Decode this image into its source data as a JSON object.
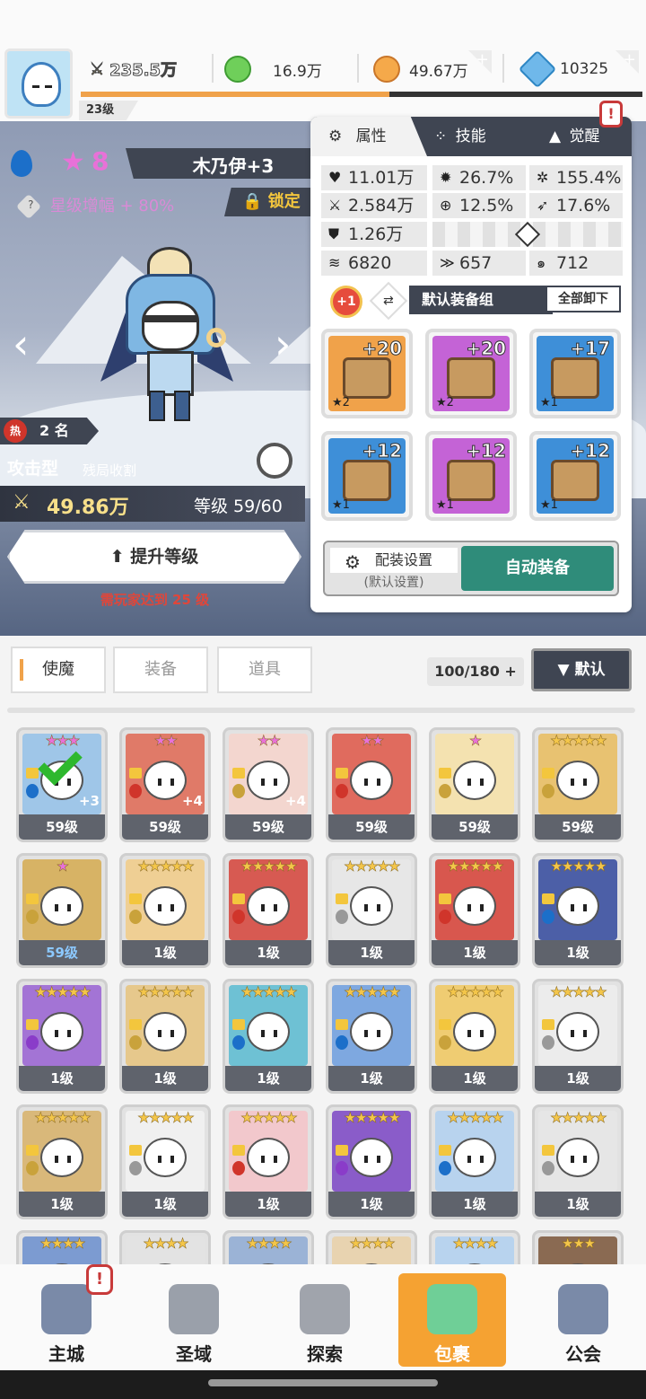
{
  "top": {
    "player_level": "23级",
    "power": "235.5万",
    "resources": [
      {
        "icon": "green-gem-icon",
        "value": "16.9万"
      },
      {
        "icon": "gold-coin-icon",
        "value": "49.67万"
      },
      {
        "icon": "blue-diamond-icon",
        "value": "10325"
      }
    ],
    "xp_fraction": 0.55
  },
  "hero": {
    "star_count": "8",
    "name": "木乃伊+3",
    "star_amp": "星级增幅 + 80%",
    "lock_label": "锁定",
    "hot_rank": "2 名",
    "hot_label": "热",
    "type": "攻击型",
    "type_desc": "残局收割",
    "power": "49.86万",
    "level_text": "等级 59/60",
    "upgrade_label": "提升等级",
    "requirement": "需玩家达到 25 级"
  },
  "panel": {
    "tabs": [
      "属性",
      "技能",
      "觉醒"
    ],
    "alert": "!",
    "stats": [
      {
        "icon": "heart-icon",
        "value": "11.01万"
      },
      {
        "icon": "burst-icon",
        "value": "26.7%"
      },
      {
        "icon": "sun-icon",
        "value": "155.4%"
      },
      {
        "icon": "sword-icon",
        "value": "2.584万"
      },
      {
        "icon": "crosshair-icon",
        "value": "12.5%"
      },
      {
        "icon": "dash-icon",
        "value": "17.6%"
      },
      {
        "icon": "shield-icon",
        "value": "1.26万"
      },
      {
        "icon": "wing-icon",
        "value": "6820"
      },
      {
        "icon": "dodge-icon",
        "value": "657"
      },
      {
        "icon": "swirl-icon",
        "value": "712"
      }
    ],
    "set_plus": "+1",
    "set_name": "默认装备组",
    "unequip_all": "全部卸下",
    "equipment": [
      {
        "name": "sword",
        "level": "+20",
        "stars": "★2",
        "color": "#f0a24a"
      },
      {
        "name": "helmet",
        "level": "+20",
        "stars": "★2",
        "color": "#c463d6"
      },
      {
        "name": "armor",
        "level": "+17",
        "stars": "★1",
        "color": "#3e8fd8"
      },
      {
        "name": "belt",
        "level": "+12",
        "stars": "★1",
        "color": "#3e8fd8"
      },
      {
        "name": "necklace",
        "level": "+12",
        "stars": "★1",
        "color": "#c463d6"
      },
      {
        "name": "boots",
        "level": "+12",
        "stars": "★1",
        "color": "#3e8fd8"
      }
    ],
    "config_label": "配装设置",
    "config_sub": "(默认设置)",
    "auto_equip": "自动装备"
  },
  "inventory": {
    "tabs": [
      "使魔",
      "装备",
      "道具"
    ],
    "capacity": "100/180",
    "capacity_plus": "+",
    "sort_label": "▼ 默认",
    "cards": [
      {
        "stars": "★★★",
        "pink": true,
        "level": "59级",
        "bg": "#9fc6e8",
        "el": "#1c6fc9",
        "plus": "+3",
        "check": true
      },
      {
        "stars": "★★",
        "pink": true,
        "level": "59级",
        "bg": "#e07a68",
        "el": "#d0352b",
        "plus": "+4"
      },
      {
        "stars": "★★",
        "pink": true,
        "level": "59级",
        "bg": "#f3d6cf",
        "el": "#c9a23b",
        "plus": "+4"
      },
      {
        "stars": "★★",
        "pink": true,
        "level": "59级",
        "bg": "#e06b5e",
        "el": "#d0352b"
      },
      {
        "stars": "★",
        "pink": true,
        "level": "59级",
        "bg": "#f4e2b0",
        "el": "#c9a23b"
      },
      {
        "stars": "★★★★★",
        "level": "59级",
        "bg": "#e8c271",
        "el": "#c9a23b"
      },
      {
        "stars": "★",
        "pink": true,
        "level": "59级",
        "bg": "#d7b365",
        "el": "#c9a23b",
        "blue": true
      },
      {
        "stars": "★★★★★",
        "level": "1级",
        "bg": "#efcf94",
        "el": "#c9a23b"
      },
      {
        "stars": "★★★★★",
        "level": "1级",
        "bg": "#d75a52",
        "el": "#d0352b"
      },
      {
        "stars": "★★★★★",
        "level": "1级",
        "bg": "#e7e7e7",
        "el": "#999"
      },
      {
        "stars": "★★★★★",
        "level": "1级",
        "bg": "#d8574e",
        "el": "#d0352b"
      },
      {
        "stars": "★★★★★",
        "level": "1级",
        "bg": "#4c5fa7",
        "el": "#1c6fc9"
      },
      {
        "stars": "★★★★★",
        "level": "1级",
        "bg": "#a374d5",
        "el": "#8a3cc9"
      },
      {
        "stars": "★★★★★",
        "level": "1级",
        "bg": "#e6c88c",
        "el": "#c9a23b"
      },
      {
        "stars": "★★★★★",
        "level": "1级",
        "bg": "#6ec1d4",
        "el": "#1c6fc9"
      },
      {
        "stars": "★★★★★",
        "level": "1级",
        "bg": "#7ea8e0",
        "el": "#1c6fc9"
      },
      {
        "stars": "★★★★★",
        "level": "1级",
        "bg": "#efcc72",
        "el": "#c9a23b"
      },
      {
        "stars": "★★★★★",
        "level": "1级",
        "bg": "#ececec",
        "el": "#999"
      },
      {
        "stars": "★★★★★",
        "level": "1级",
        "bg": "#d9b87a",
        "el": "#c9a23b"
      },
      {
        "stars": "★★★★★",
        "level": "1级",
        "bg": "#f0f0f0",
        "el": "#999"
      },
      {
        "stars": "★★★★★",
        "level": "1级",
        "bg": "#f2c8cc",
        "el": "#d0352b"
      },
      {
        "stars": "★★★★★",
        "level": "1级",
        "bg": "#8a5cc9",
        "el": "#8a3cc9"
      },
      {
        "stars": "★★★★★",
        "level": "1级",
        "bg": "#b8d3ee",
        "el": "#1c6fc9"
      },
      {
        "stars": "★★★★★",
        "level": "1级",
        "bg": "#e6e6e6",
        "el": "#999"
      },
      {
        "stars": "★★★★",
        "level": "",
        "bg": "#7c9bd1",
        "el": ""
      },
      {
        "stars": "★★★★",
        "level": "",
        "bg": "#e3e3e3",
        "el": ""
      },
      {
        "stars": "★★★★",
        "level": "",
        "bg": "#9bb3d6",
        "el": ""
      },
      {
        "stars": "★★★★",
        "level": "",
        "bg": "#e8d3b0",
        "el": ""
      },
      {
        "stars": "★★★★",
        "level": "",
        "bg": "#b8d3ee",
        "el": ""
      },
      {
        "stars": "★★★",
        "level": "",
        "bg": "#8a6a52",
        "el": ""
      }
    ]
  },
  "nav": {
    "alert": "!",
    "items": [
      {
        "label": "主城",
        "icon": "castle-icon",
        "color": "#7a8aa8"
      },
      {
        "label": "圣域",
        "icon": "vortex-icon",
        "color": "#9aa0aa"
      },
      {
        "label": "探索",
        "icon": "sword-stone-icon",
        "color": "#a0a4ac"
      },
      {
        "label": "包裹",
        "icon": "bag-slime-icon",
        "color": "#6fcf97"
      },
      {
        "label": "公会",
        "icon": "guild-helmet-icon",
        "color": "#7a8aa8"
      }
    ],
    "active_index": 3
  }
}
